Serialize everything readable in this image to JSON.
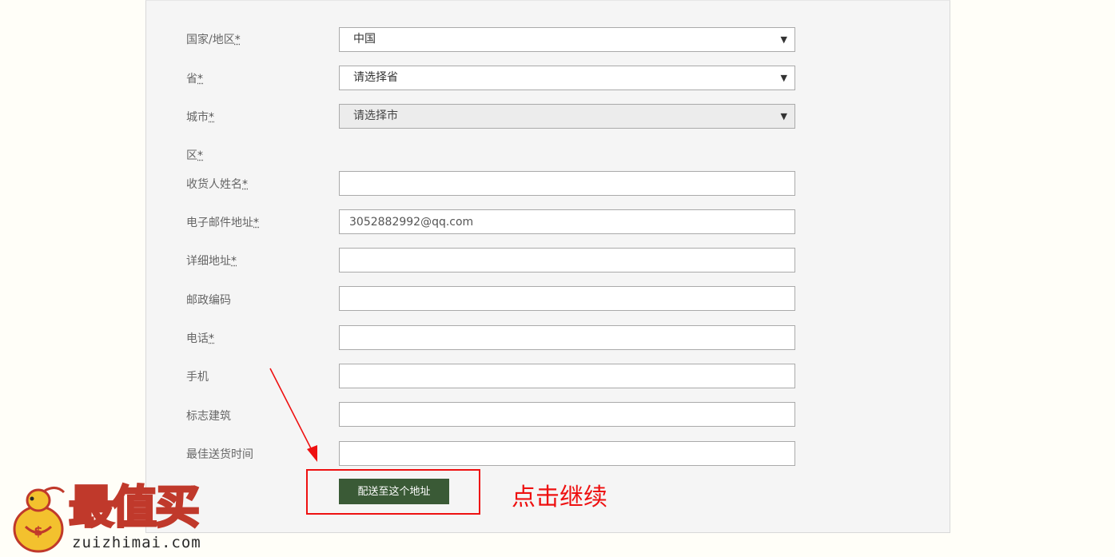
{
  "form": {
    "country": {
      "label": "国家/地区",
      "req": "*",
      "value": "中国"
    },
    "province": {
      "label": "省",
      "req": "*",
      "value": "请选择省"
    },
    "city": {
      "label": "城市",
      "req": "*",
      "value": "请选择市"
    },
    "district": {
      "label": "区",
      "req": "*"
    },
    "name": {
      "label": "收货人姓名",
      "req": "*",
      "value": ""
    },
    "email": {
      "label": "电子邮件地址",
      "req": "*",
      "value": "3052882992@qq.com"
    },
    "address": {
      "label": "详细地址",
      "req": "*",
      "value": ""
    },
    "zipcode": {
      "label": "邮政编码",
      "value": ""
    },
    "phone": {
      "label": "电话",
      "req": "*",
      "value": ""
    },
    "mobile": {
      "label": "手机",
      "value": ""
    },
    "landmark": {
      "label": "标志建筑",
      "value": ""
    },
    "delivery_time": {
      "label": "最佳送货时间",
      "value": ""
    },
    "submit_label": "配送至这个地址"
  },
  "annotation": {
    "text": "点击继续",
    "color": "#ee1111"
  },
  "watermark": {
    "title": "最值买",
    "url": "zuizhimai.com"
  },
  "colors": {
    "button_bg": "#3a5a36",
    "watermark_fill": "#f3c12e",
    "watermark_stroke": "#c0392b"
  }
}
